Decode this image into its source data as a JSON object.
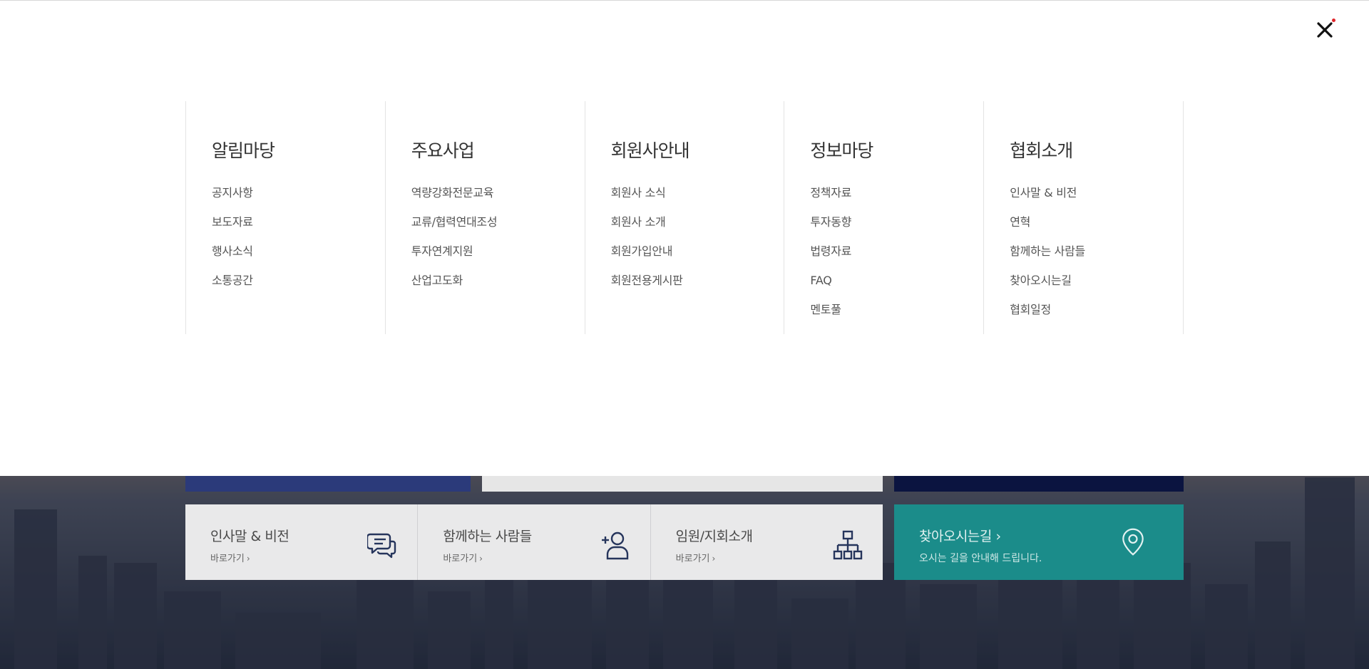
{
  "close_label": "✕",
  "menu": [
    {
      "heading": "알림마당",
      "items": [
        "공지사항",
        "보도자료",
        "행사소식",
        "소통공간"
      ]
    },
    {
      "heading": "주요사업",
      "items": [
        "역량강화전문교육",
        "교류/협력연대조성",
        "투자연계지원",
        "산업고도화"
      ]
    },
    {
      "heading": "회원사안내",
      "items": [
        "회원사 소식",
        "회원사 소개",
        "회원가입안내",
        "회원전용게시판"
      ]
    },
    {
      "heading": "정보마당",
      "items": [
        "정책자료",
        "투자동향",
        "법령자료",
        "FAQ",
        "멘토풀"
      ]
    },
    {
      "heading": "협회소개",
      "items": [
        "인사말 & 비전",
        "연혁",
        "함께하는 사람들",
        "찾아오시는길",
        "협회일정"
      ]
    }
  ],
  "quick_links": [
    {
      "title": "인사말 & 비전",
      "sub": "바로가기",
      "icon": "chat-bubbles-icon"
    },
    {
      "title": "함께하는 사람들",
      "sub": "바로가기",
      "icon": "add-person-icon"
    },
    {
      "title": "임원/지회소개",
      "sub": "바로가기",
      "icon": "org-chart-icon"
    }
  ],
  "find_us": {
    "title": "찾아오시는길",
    "sub": "오시는 길을 안내해 드립니다.",
    "icon": "location-pin-icon"
  },
  "chevron": "›",
  "colors": {
    "teal": "#1b8c8a",
    "navy": "#0b1440",
    "close_dot": "#e0262b"
  }
}
